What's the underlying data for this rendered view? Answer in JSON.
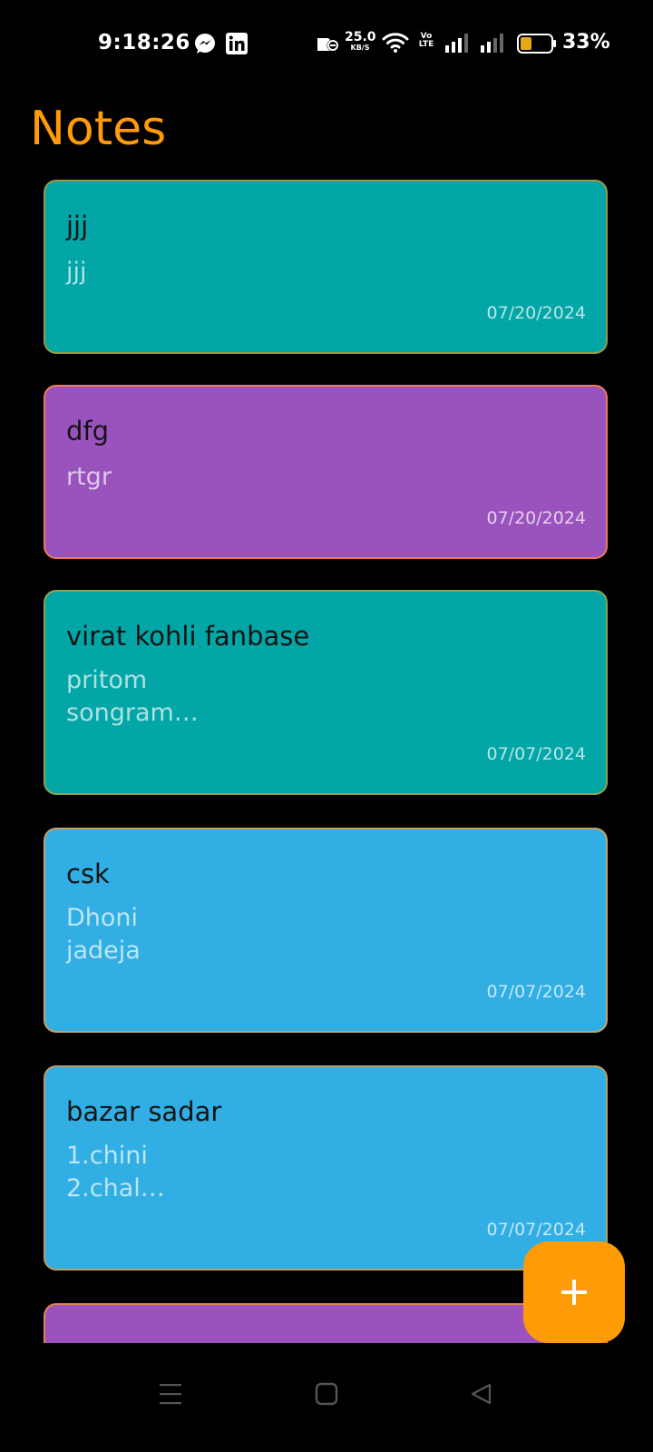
{
  "status_bar": {
    "time": "9:18:26",
    "net_speed_value": "25.0",
    "net_speed_unit": "KB/S",
    "volte_top": "Vo",
    "volte_bottom": "LTE",
    "battery_percent": "33%",
    "icons": [
      "messenger-icon",
      "linkedin-icon",
      "data-saver-icon",
      "wifi-icon",
      "signal-icon",
      "signal-icon",
      "battery-icon"
    ]
  },
  "header": {
    "title": "Notes"
  },
  "colors": {
    "accent": "#ff9b0b",
    "teal": "#03a6a6",
    "purple": "#9a53bd",
    "blue": "#31aee3"
  },
  "notes": [
    {
      "title": "jjj",
      "body": "jjj",
      "date": "07/20/2024",
      "color": "#03a6a6",
      "border": "#9a9a44"
    },
    {
      "title": "dfg",
      "body": "rtgr",
      "date": "07/20/2024",
      "color": "#9a53bd",
      "border": "#ee7a5a"
    },
    {
      "title": "virat kohli fanbase",
      "body": "pritom\nsongram…",
      "date": "07/07/2024",
      "color": "#03a6a6",
      "border": "#8fa448"
    },
    {
      "title": "csk",
      "body": "Dhoni\njadeja",
      "date": "07/07/2024",
      "color": "#31aee3",
      "border": "#c2a468"
    },
    {
      "title": "bazar sadar",
      "body": "1.chini\n2.chal…",
      "date": "07/07/2024",
      "color": "#31aee3",
      "border": "#b8a066"
    },
    {
      "title": "",
      "body": "",
      "date": "",
      "color": "#9a53bd",
      "border": "#e3864f"
    }
  ],
  "fab": {
    "label": "+",
    "icon": "plus-icon"
  },
  "nav_bar": {
    "icons": [
      "menu-icon",
      "home-square-icon",
      "back-triangle-icon"
    ]
  }
}
